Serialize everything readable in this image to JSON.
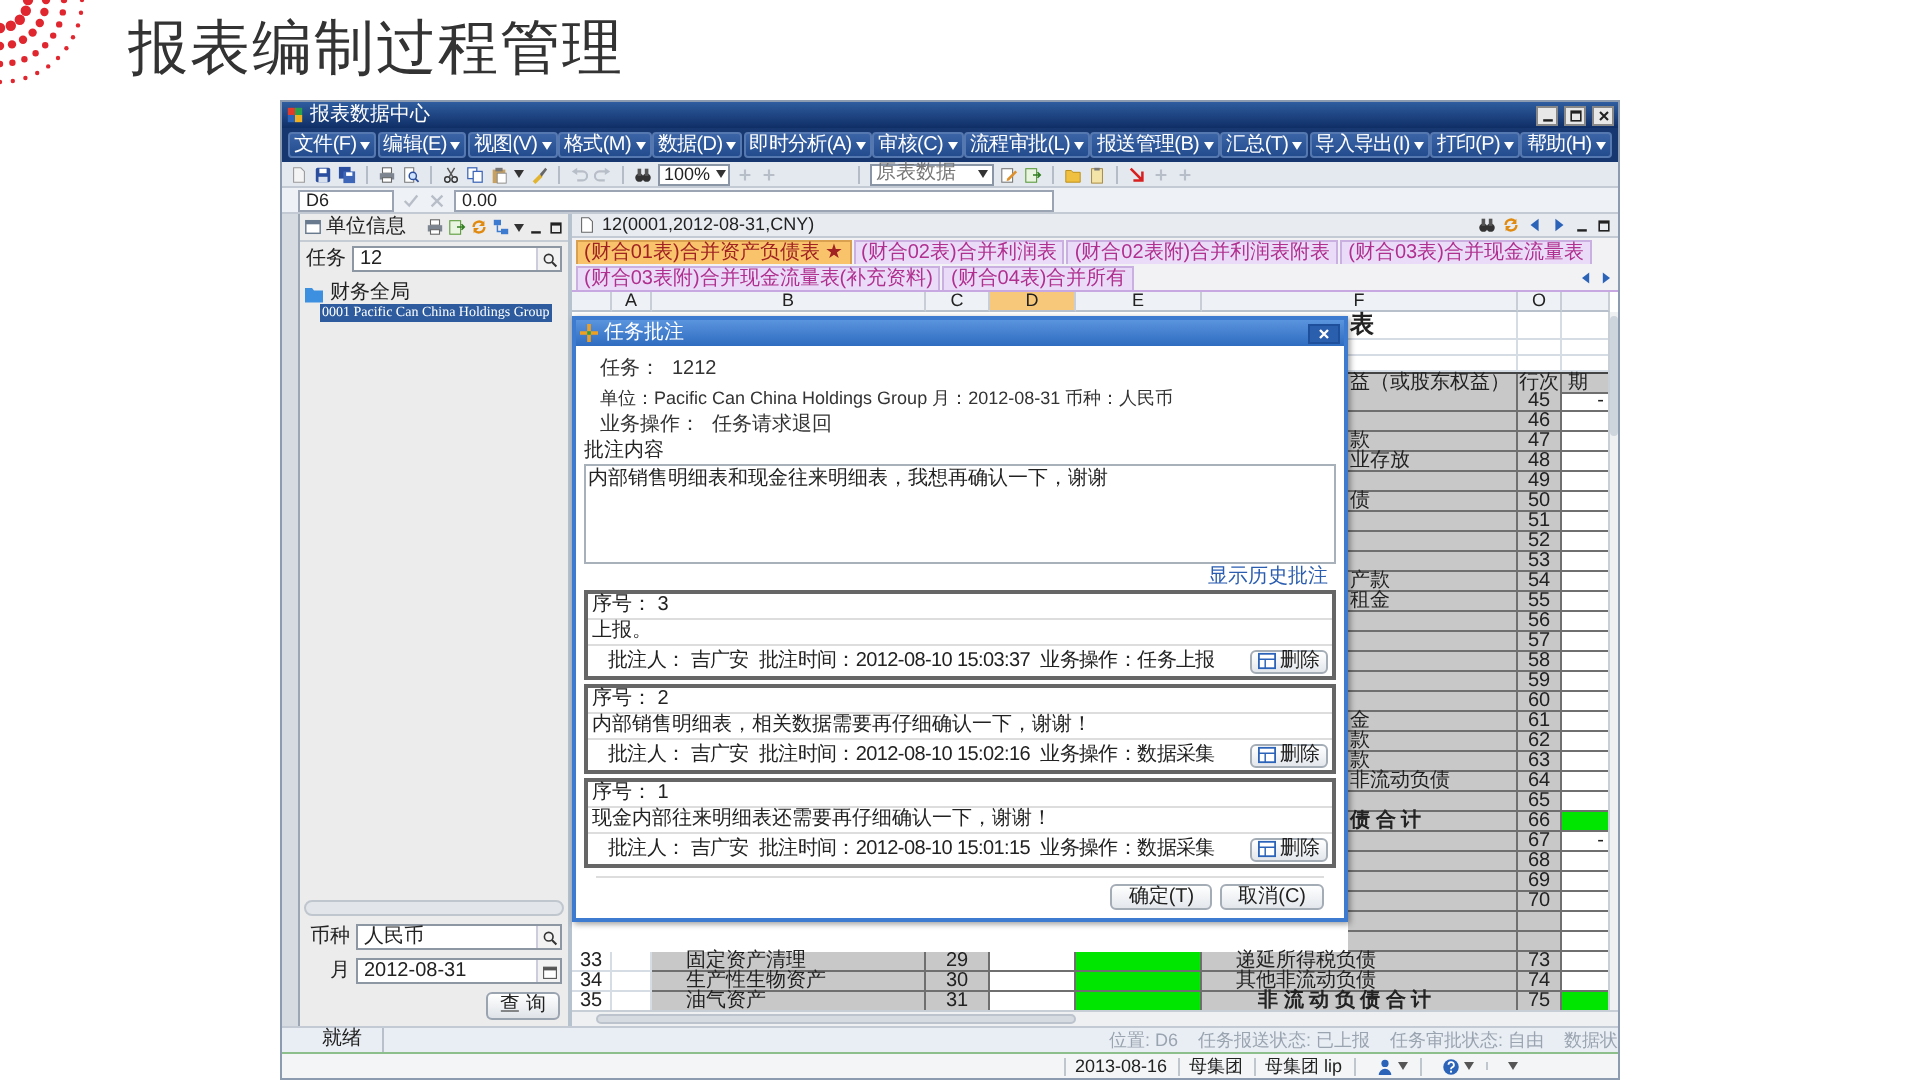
{
  "slide": {
    "title": "报表编制过程管理"
  },
  "window": {
    "title": "报表数据中心"
  },
  "menu": [
    "文件(F)",
    "编辑(E)",
    "视图(V)",
    "格式(M)",
    "数据(D)",
    "即时分析(A)",
    "审核(C)",
    "流程审批(L)",
    "报送管理(B)",
    "汇总(T)",
    "导入导出(I)",
    "打印(P)",
    "帮助(H)"
  ],
  "toolbar": {
    "zoom": "100%",
    "data_source": "原表数据"
  },
  "formula_bar": {
    "cell": "D6",
    "value": "0.00"
  },
  "unit_panel": {
    "title": "单位信息",
    "task_label": "任务",
    "task_value": "12",
    "tree": [
      {
        "label": "财务全局",
        "selected": false,
        "children": [
          {
            "label": "0001 Pacific Can China Holdings Group",
            "selected": true
          }
        ]
      }
    ],
    "currency_label": "币种",
    "currency_value": "人民币",
    "month_label": "月",
    "month_value": "2012-08-31",
    "query_button": "查 询"
  },
  "report": {
    "title": "12(0001,2012-08-31,CNY)",
    "sheet_tabs": [
      {
        "label": "(财合01表)合并资产负债表 ★",
        "selected": true
      },
      {
        "label": "(财合02表)合并利润表",
        "selected": false
      },
      {
        "label": "(财合02表附)合并利润表附表",
        "selected": false
      },
      {
        "label": "(财合03表)合并现金流量表",
        "selected": false
      },
      {
        "label": "(财合03表附)合并现金流量表(补充资料)",
        "selected": false
      },
      {
        "label": "(财合04表)合并所有",
        "selected": false
      }
    ],
    "columns": [
      {
        "label": "A",
        "selected": false
      },
      {
        "label": "B",
        "selected": false
      },
      {
        "label": "C",
        "selected": false
      },
      {
        "label": "D",
        "selected": true
      },
      {
        "label": "E",
        "selected": false
      },
      {
        "label": "F",
        "selected": false
      },
      {
        "label": "O",
        "selected": false
      }
    ],
    "grid": {
      "caption": "表",
      "header": {
        "item": "益（或股东权益）",
        "line": "行次",
        "period": "期"
      },
      "rows": [
        {
          "kind": "item",
          "line": "45",
          "value": "-",
          "highlighted": false
        },
        {
          "kind": "item",
          "line": "46",
          "highlighted": false
        },
        {
          "kind": "item",
          "item": "款",
          "line": "47",
          "highlighted": false
        },
        {
          "kind": "item",
          "item": "业存放",
          "line": "48",
          "highlighted": false
        },
        {
          "kind": "item",
          "line": "49",
          "highlighted": false
        },
        {
          "kind": "item",
          "item": "债",
          "line": "50",
          "highlighted": false
        },
        {
          "kind": "item",
          "line": "51",
          "highlighted": false
        },
        {
          "kind": "item",
          "line": "52",
          "highlighted": false
        },
        {
          "kind": "item",
          "line": "53",
          "highlighted": false
        },
        {
          "kind": "item",
          "item": "产款",
          "line": "54",
          "highlighted": false
        },
        {
          "kind": "item",
          "item": "租金",
          "line": "55",
          "highlighted": false
        },
        {
          "kind": "item",
          "line": "56",
          "highlighted": false
        },
        {
          "kind": "item",
          "line": "57",
          "highlighted": false
        },
        {
          "kind": "item",
          "line": "58",
          "highlighted": false
        },
        {
          "kind": "item",
          "line": "59",
          "highlighted": false
        },
        {
          "kind": "item",
          "line": "60",
          "highlighted": false
        },
        {
          "kind": "item",
          "item": "金",
          "line": "61",
          "highlighted": false
        },
        {
          "kind": "item",
          "item": "款",
          "line": "62",
          "highlighted": false
        },
        {
          "kind": "item",
          "item": "款",
          "line": "63",
          "highlighted": false
        },
        {
          "kind": "item",
          "item": "非流动负债",
          "line": "64",
          "highlighted": false
        },
        {
          "kind": "item",
          "line": "65",
          "highlighted": false
        },
        {
          "kind": "total",
          "item": "债 合 计",
          "line": "66",
          "highlighted": true
        },
        {
          "kind": "item",
          "line": "67",
          "value": "-",
          "highlighted": false
        },
        {
          "kind": "item",
          "line": "68",
          "highlighted": false
        },
        {
          "kind": "item",
          "line": "69",
          "highlighted": false
        },
        {
          "kind": "item",
          "line": "70",
          "highlighted": false
        },
        {
          "kind": "item",
          "highlighted": false
        },
        {
          "kind": "item",
          "highlighted": false
        },
        {
          "kind": "item",
          "number": "33",
          "left_item": "固定资产清理",
          "left_line": "29",
          "left_highlighted": true,
          "item": "递延所得税负债",
          "line": "73",
          "highlighted": false
        },
        {
          "kind": "item",
          "number": "34",
          "left_item": "生产性生物资产",
          "left_line": "30",
          "left_highlighted": true,
          "item": "其他非流动负债",
          "line": "74",
          "highlighted": false
        },
        {
          "kind": "total",
          "number": "35",
          "left_item": "油气资产",
          "left_line": "31",
          "left_highlighted": true,
          "item": "非 流 动 负 债 合 计",
          "line": "75",
          "highlighted": true
        }
      ]
    }
  },
  "dialog": {
    "title": "任务批注",
    "task_label": "任务：",
    "task_value": "1212",
    "unit_line": "单位：Pacific Can China Holdings Group 月：2012-08-31 币种：人民币",
    "operation_label": "业务操作：",
    "operation_value": "任务请求退回",
    "comment_label": "批注内容",
    "comment_value": "内部销售明细表和现金往来明细表，我想再确认一下，谢谢",
    "history_link": "显示历史批注",
    "history": [
      {
        "number": "序号： 3",
        "text": "上报。",
        "commenter": "批注人： 吉广安",
        "time": "批注时间：2012-08-10 15:03:37",
        "operation": "业务操作：任务上报",
        "delete": "删除"
      },
      {
        "number": "序号： 2",
        "text": "内部销售明细表，相关数据需要再仔细确认一下，谢谢！",
        "commenter": "批注人： 吉广安",
        "time": "批注时间：2012-08-10 15:02:16",
        "operation": "业务操作：数据采集",
        "delete": "删除"
      },
      {
        "number": "序号： 1",
        "text": "现金内部往来明细表还需要再仔细确认一下，谢谢！",
        "commenter": "批注人： 吉广安",
        "time": "批注时间：2012-08-10 15:01:15",
        "operation": "业务操作：数据采集",
        "delete": "删除"
      }
    ],
    "buttons": [
      "确定(T)",
      "取消(C)"
    ]
  },
  "status_bar": {
    "state": "就绪",
    "items": [
      "位置: D6",
      "任务报送状态: 已上报",
      "任务审批状态: 自由",
      "数据状"
    ]
  },
  "taskbar": {
    "items": [
      "2013-08-16",
      "母集团",
      "母集团 lip"
    ]
  }
}
